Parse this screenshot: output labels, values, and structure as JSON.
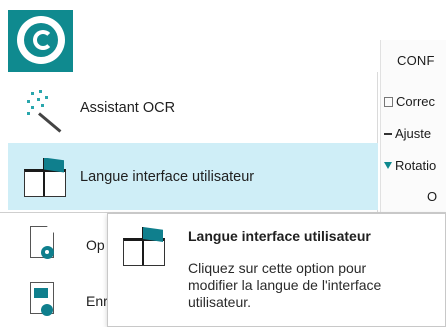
{
  "app_button": {
    "icon": "app-logo-icon"
  },
  "ribbon": {
    "tab_label": "CONF",
    "commands": [
      {
        "label": "Correc",
        "icon": "document-icon"
      },
      {
        "label": "Ajuste",
        "icon": "dash-icon"
      },
      {
        "label": "Rotatio",
        "icon": "rotate-icon"
      }
    ],
    "partial_text": "O"
  },
  "menu": {
    "items": [
      {
        "label": "Assistant OCR",
        "icon": "magic-wand-icon"
      },
      {
        "label": "Langue interface utilisateur",
        "icon": "flag-screen-icon",
        "selected": true
      }
    ]
  },
  "lower_menu": {
    "items": [
      {
        "label": "Op",
        "icon": "document-gear-icon"
      },
      {
        "label": "Enr",
        "icon": "save-document-icon"
      }
    ]
  },
  "tooltip": {
    "title": "Langue interface utilisateur",
    "body": "Cliquez sur cette option pour\nmodifier la langue de l'interface\nutilisateur.",
    "icon": "flag-screen-icon"
  },
  "colors": {
    "accent": "#0f8a8f",
    "selected_bg": "#cfeef7"
  }
}
